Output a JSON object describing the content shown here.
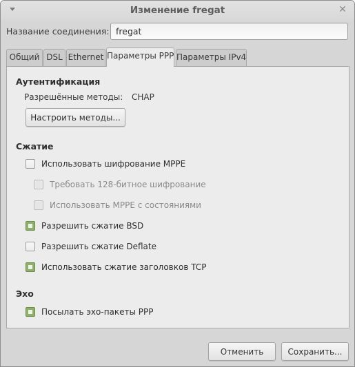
{
  "window": {
    "title": "Изменение fregat",
    "menu_icon": "triangle-down-icon",
    "close_icon": "close-icon",
    "close_glyph": "✕"
  },
  "connection": {
    "label": "Название соединения:",
    "value": "fregat"
  },
  "tabs": [
    {
      "label": "Общий",
      "active": false
    },
    {
      "label": "DSL",
      "active": false
    },
    {
      "label": "Ethernet",
      "active": false
    },
    {
      "label": "Параметры PPP",
      "active": true
    },
    {
      "label": "Параметры IPv4",
      "active": false
    }
  ],
  "auth": {
    "heading": "Аутентификация",
    "methods_label": "Разрешённые методы:",
    "methods_value": "CHAP",
    "configure_button": "Настроить методы..."
  },
  "compression": {
    "heading": "Сжатие",
    "options": [
      {
        "label": "Использовать шифрование MPPE",
        "checked": false,
        "enabled": true
      },
      {
        "label": "Требовать 128-битное шифрование",
        "checked": false,
        "enabled": false
      },
      {
        "label": "Использовать MPPE с состояниями",
        "checked": false,
        "enabled": false
      },
      {
        "label": "Разрешить сжатие BSD",
        "checked": true,
        "enabled": true
      },
      {
        "label": "Разрешить сжатие Deflate",
        "checked": false,
        "enabled": true
      },
      {
        "label": "Использовать сжатие заголовков TCP",
        "checked": true,
        "enabled": true
      }
    ]
  },
  "echo": {
    "heading": "Эхо",
    "options": [
      {
        "label": "Посылать эхо-пакеты PPP",
        "checked": true,
        "enabled": true
      }
    ]
  },
  "footer": {
    "cancel_button": "Отменить",
    "save_button": "Сохранить..."
  },
  "colors": {
    "checkbox_checked": "#8fb06c",
    "panel_bg": "#ececec",
    "window_bg": "#d6d6d6"
  }
}
